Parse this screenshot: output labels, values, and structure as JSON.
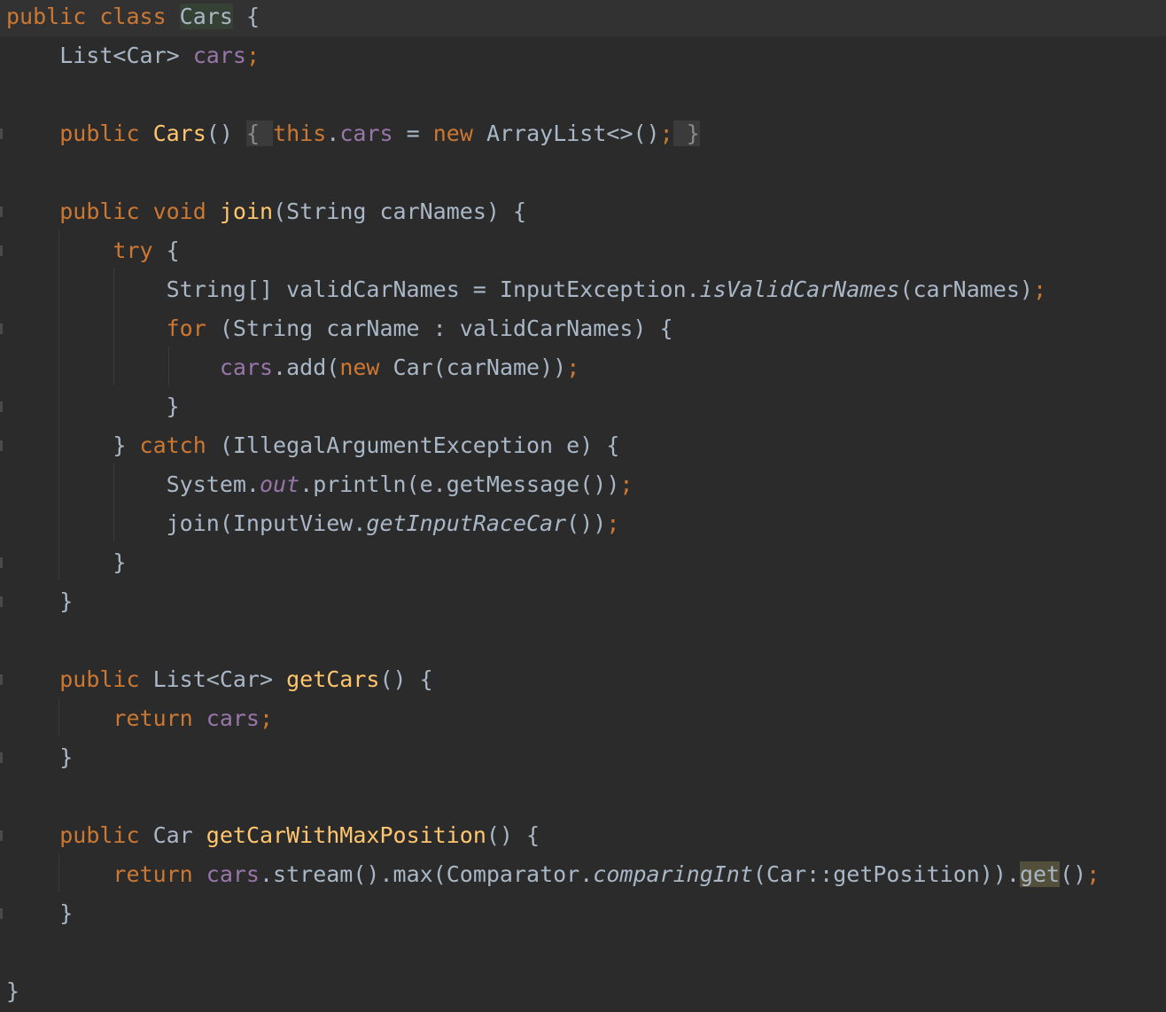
{
  "editor": {
    "lines": [
      {
        "current": true,
        "tokens": [
          {
            "t": "public class ",
            "c": "kw"
          },
          {
            "t": "Cars",
            "c": "hl-cls"
          },
          {
            "t": " {"
          }
        ]
      },
      {
        "tokens": [
          {
            "t": "    List<Car> "
          },
          {
            "t": "cars",
            "c": "field"
          },
          {
            "t": ";",
            "c": "kw"
          }
        ]
      },
      {
        "tokens": []
      },
      {
        "fold": true,
        "tokens": [
          {
            "t": "    "
          },
          {
            "t": "public ",
            "c": "kw"
          },
          {
            "t": "Cars",
            "c": "fn"
          },
          {
            "t": "() "
          },
          {
            "t": "{ ",
            "c": "fold-dim"
          },
          {
            "t": "this",
            "c": "kw"
          },
          {
            "t": "."
          },
          {
            "t": "cars",
            "c": "field"
          },
          {
            "t": " = "
          },
          {
            "t": "new ",
            "c": "kw"
          },
          {
            "t": "ArrayList<>()"
          },
          {
            "t": ";",
            "c": "kw"
          },
          {
            "t": " }",
            "c": "fold-dim"
          }
        ]
      },
      {
        "tokens": []
      },
      {
        "fold": true,
        "tokens": [
          {
            "t": "    "
          },
          {
            "t": "public void ",
            "c": "kw"
          },
          {
            "t": "join",
            "c": "fn"
          },
          {
            "t": "(String carNames) {"
          }
        ]
      },
      {
        "fold": true,
        "tokens": [
          {
            "t": "        "
          },
          {
            "t": "try ",
            "c": "kw"
          },
          {
            "t": "{"
          }
        ]
      },
      {
        "tokens": [
          {
            "t": "            String[] validCarNames = InputException."
          },
          {
            "t": "isValidCarNames",
            "c": "si"
          },
          {
            "t": "(carNames)"
          },
          {
            "t": ";",
            "c": "kw"
          }
        ]
      },
      {
        "fold": true,
        "tokens": [
          {
            "t": "            "
          },
          {
            "t": "for ",
            "c": "kw"
          },
          {
            "t": "(String carName : validCarNames) {"
          }
        ]
      },
      {
        "tokens": [
          {
            "t": "                "
          },
          {
            "t": "cars",
            "c": "field"
          },
          {
            "t": ".add("
          },
          {
            "t": "new ",
            "c": "kw"
          },
          {
            "t": "Car(carName))"
          },
          {
            "t": ";",
            "c": "kw"
          }
        ]
      },
      {
        "fold": true,
        "tokens": [
          {
            "t": "            }"
          }
        ]
      },
      {
        "fold": true,
        "tokens": [
          {
            "t": "        } "
          },
          {
            "t": "catch ",
            "c": "kw"
          },
          {
            "t": "(IllegalArgumentException e) {"
          }
        ]
      },
      {
        "tokens": [
          {
            "t": "            System."
          },
          {
            "t": "out",
            "c": "sf"
          },
          {
            "t": ".println(e.getMessage())"
          },
          {
            "t": ";",
            "c": "kw"
          }
        ]
      },
      {
        "tokens": [
          {
            "t": "            join(InputView."
          },
          {
            "t": "getInputRaceCar",
            "c": "si"
          },
          {
            "t": "())"
          },
          {
            "t": ";",
            "c": "kw"
          }
        ]
      },
      {
        "fold": true,
        "tokens": [
          {
            "t": "        }"
          }
        ]
      },
      {
        "fold": true,
        "tokens": [
          {
            "t": "    }"
          }
        ]
      },
      {
        "tokens": []
      },
      {
        "fold": true,
        "tokens": [
          {
            "t": "    "
          },
          {
            "t": "public ",
            "c": "kw"
          },
          {
            "t": "List<Car> "
          },
          {
            "t": "getCars",
            "c": "fn"
          },
          {
            "t": "() {"
          }
        ]
      },
      {
        "tokens": [
          {
            "t": "        "
          },
          {
            "t": "return ",
            "c": "kw"
          },
          {
            "t": "cars",
            "c": "field"
          },
          {
            "t": ";",
            "c": "kw"
          }
        ]
      },
      {
        "fold": true,
        "tokens": [
          {
            "t": "    }"
          }
        ]
      },
      {
        "tokens": []
      },
      {
        "fold": true,
        "tokens": [
          {
            "t": "    "
          },
          {
            "t": "public ",
            "c": "kw"
          },
          {
            "t": "Car "
          },
          {
            "t": "getCarWithMaxPosition",
            "c": "fn"
          },
          {
            "t": "() {"
          }
        ]
      },
      {
        "tokens": [
          {
            "t": "        "
          },
          {
            "t": "return ",
            "c": "kw"
          },
          {
            "t": "cars",
            "c": "field"
          },
          {
            "t": ".stream().max(Comparator."
          },
          {
            "t": "comparingInt",
            "c": "si"
          },
          {
            "t": "(Car::getPosition))."
          },
          {
            "t": "get",
            "c": "usage"
          },
          {
            "t": "()"
          },
          {
            "t": ";",
            "c": "kw"
          }
        ]
      },
      {
        "fold": true,
        "tokens": [
          {
            "t": "    }"
          }
        ]
      },
      {
        "tokens": []
      },
      {
        "tokens": [
          {
            "t": "}"
          }
        ]
      }
    ]
  },
  "colors": {
    "background": "#2b2b2b",
    "current_line": "#323232",
    "keyword": "#cc7832",
    "method_declaration": "#ffc66d",
    "field": "#9876aa",
    "default_text": "#a9b7c6",
    "class_highlight": "#344134",
    "usage_highlight": "#52503a"
  }
}
